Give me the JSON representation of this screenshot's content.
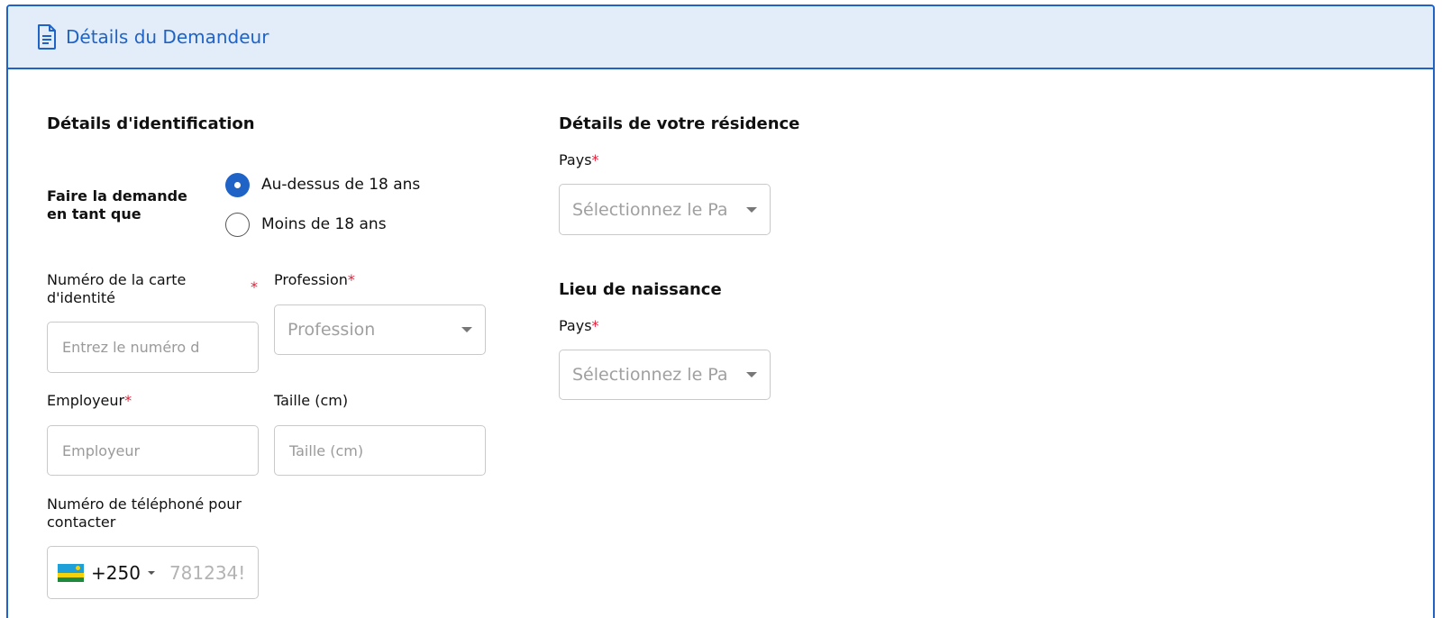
{
  "header": {
    "title": "Détails du Demandeur",
    "icon": "document-icon",
    "accent": "#1f63c6",
    "background": "#e2edf9"
  },
  "identification": {
    "title": "Détails d'identification",
    "apply_as_label_line1": "Faire la demande",
    "apply_as_label_line2": "en tant que",
    "radio_options": [
      {
        "label": "Au-dessus de 18 ans",
        "checked": true
      },
      {
        "label": "Moins de 18 ans",
        "checked": false
      }
    ],
    "id_card": {
      "label_line1": "Numéro de la carte",
      "label_line2": "d'identité",
      "required_mark": "*",
      "placeholder": "Entrez le numéro d"
    },
    "profession": {
      "label": "Profession",
      "required_mark": "*",
      "placeholder": "Profession"
    },
    "employer": {
      "label": "Employeur",
      "required_mark": "*",
      "placeholder": "Employeur"
    },
    "height": {
      "label": "Taille (cm)",
      "placeholder": "Taille (cm)"
    },
    "phone": {
      "label_line1": "Numéro de téléphoné pour",
      "label_line2": "contacter",
      "dial_code": "+250",
      "placeholder": "781234!"
    }
  },
  "residence": {
    "title": "Détails de votre résidence",
    "country_label": "Pays",
    "required_mark": "*",
    "placeholder": "Sélectionnez le Pa"
  },
  "birthplace": {
    "title": "Lieu de naissance",
    "country_label": "Pays",
    "required_mark": "*",
    "placeholder": "Sélectionnez le Pa"
  }
}
